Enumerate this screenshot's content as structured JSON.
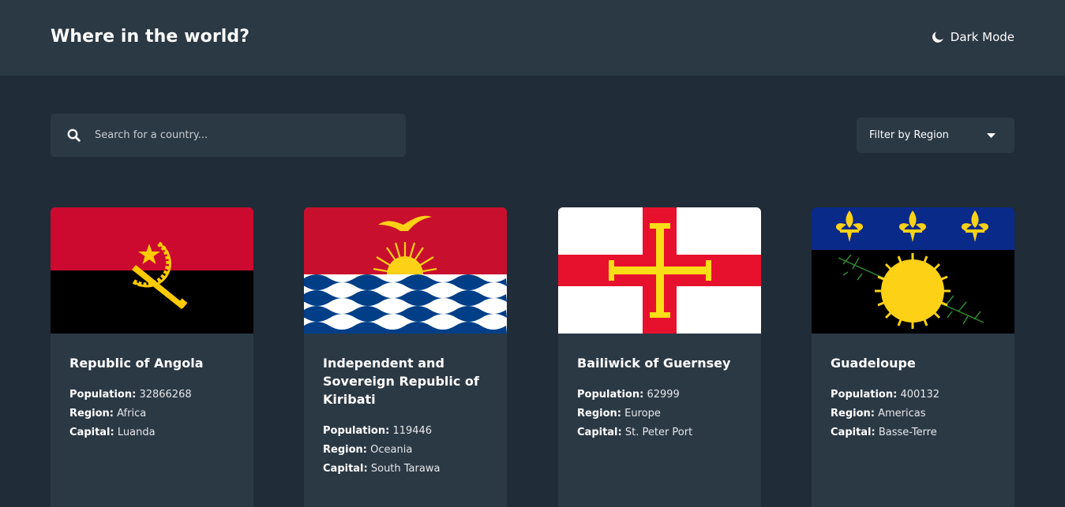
{
  "header": {
    "title": "Where in the world?",
    "mode_label": "Dark Mode"
  },
  "search": {
    "placeholder": "Search for a country..."
  },
  "filter": {
    "label": "Filter by Region"
  },
  "labels": {
    "population": "Population:",
    "region": "Region:",
    "capital": "Capital:"
  },
  "colors": {
    "background": "#202c37",
    "elements": "#2b3945",
    "text": "#ffffff"
  },
  "countries": [
    {
      "name": "Republic of Angola",
      "population": "32866268",
      "region": "Africa",
      "capital": "Luanda"
    },
    {
      "name": "Independent and Sovereign Republic of Kiribati",
      "population": "119446",
      "region": "Oceania",
      "capital": "South Tarawa"
    },
    {
      "name": "Bailiwick of Guernsey",
      "population": "62999",
      "region": "Europe",
      "capital": "St. Peter Port"
    },
    {
      "name": "Guadeloupe",
      "population": "400132",
      "region": "Americas",
      "capital": "Basse-Terre"
    }
  ]
}
